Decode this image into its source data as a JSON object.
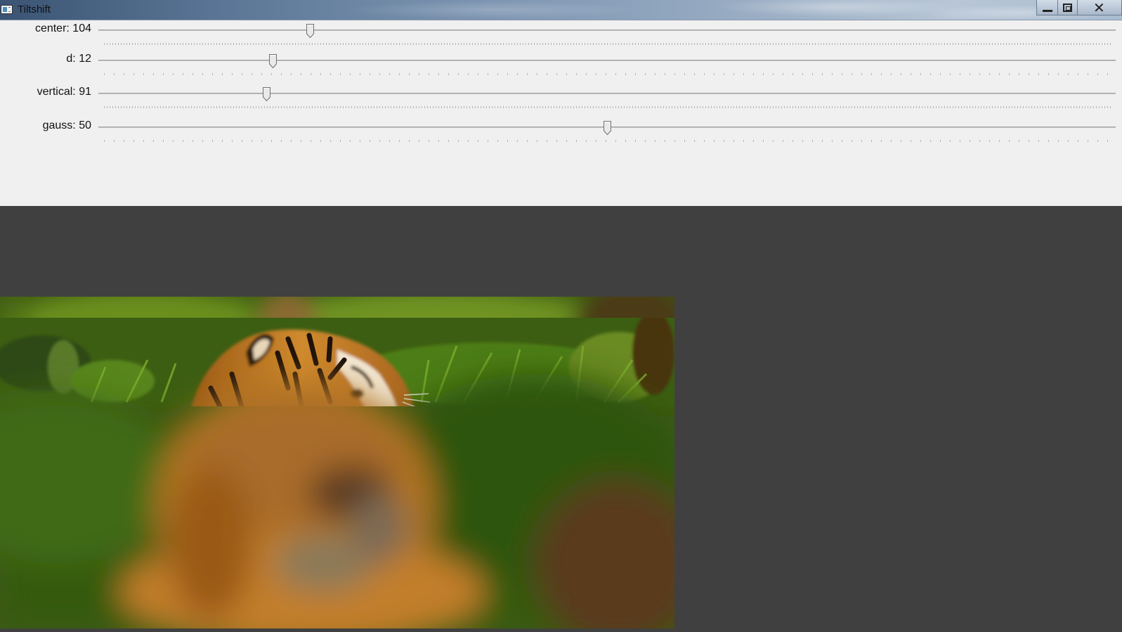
{
  "window": {
    "title": "Tiltshift",
    "icon": "app-window-icon"
  },
  "sliders": [
    {
      "name": "center",
      "label": "center: 104",
      "value": 104,
      "max": 500
    },
    {
      "name": "d",
      "label": "d: 12",
      "value": 12,
      "max": 70
    },
    {
      "name": "vertical",
      "label": "vertical: 91",
      "value": 91,
      "max": 550
    },
    {
      "name": "gauss",
      "label": "gauss: 50",
      "value": 50,
      "max": 100
    }
  ],
  "image": {
    "subject": "tiger-photo",
    "effect": "tilt-shift blur"
  },
  "colors": {
    "panel": "#f0f0f0",
    "canvas": "#404040"
  }
}
